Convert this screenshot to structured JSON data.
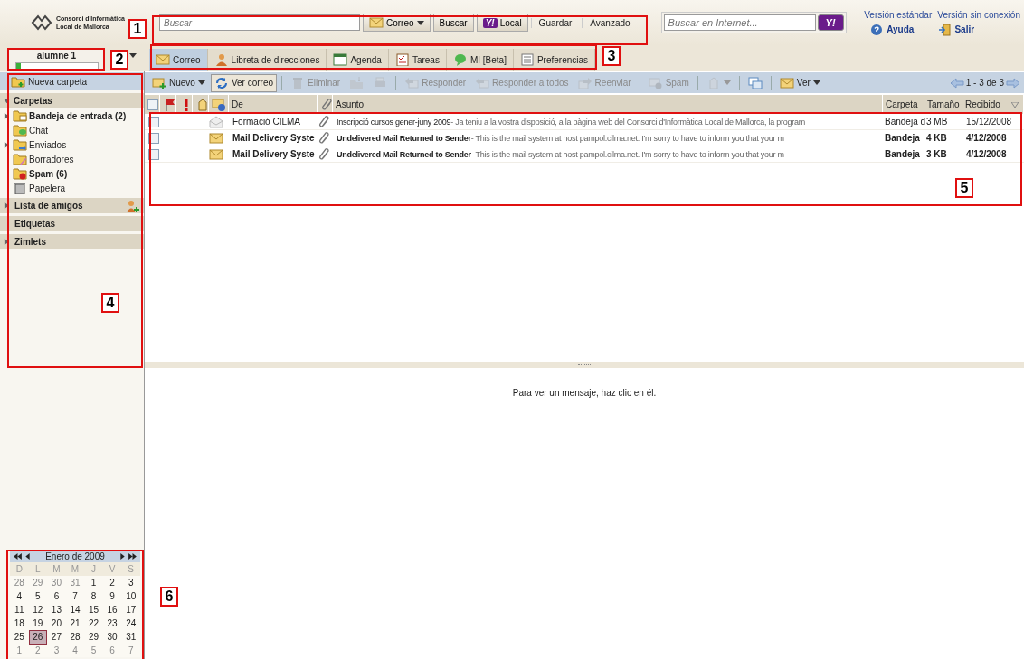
{
  "header": {
    "logo_lines": [
      "Consorci d'Informàtica",
      "Local de Mallorca"
    ],
    "search": {
      "placeholder": "Buscar"
    },
    "search_scope": "Correo",
    "search_button": "Buscar",
    "local_button": {
      "mark": "Y!",
      "label": "Local"
    },
    "save_link": "Guardar",
    "advanced_link": "Avanzado",
    "web_search": {
      "placeholder": "Buscar en Internet...",
      "mark": "Y!"
    },
    "links": [
      "Versión estándar",
      "Versión sin conexión"
    ],
    "help": "Ayuda",
    "logout": "Salir"
  },
  "user": {
    "name": "alumne 1",
    "level": 0.06
  },
  "tabs": [
    {
      "label": "Correo",
      "selected": true
    },
    {
      "label": "Libreta de direcciones",
      "selected": false
    },
    {
      "label": "Agenda",
      "selected": false
    },
    {
      "label": "Tareas",
      "selected": false
    },
    {
      "label": "MI [Beta]",
      "selected": false
    },
    {
      "label": "Preferencias",
      "selected": false
    }
  ],
  "new_folder": "Nueva carpeta",
  "folders_section": {
    "title": "Carpetas",
    "expanded": true
  },
  "folders": [
    {
      "name": "Bandeja de entrada (2)",
      "unread": true,
      "expandable": true
    },
    {
      "name": "Chat",
      "unread": false,
      "expandable": false
    },
    {
      "name": "Enviados",
      "unread": false,
      "expandable": true
    },
    {
      "name": "Borradores",
      "unread": false,
      "expandable": false
    },
    {
      "name": "Spam (6)",
      "unread": true,
      "expandable": false
    },
    {
      "name": "Papelera",
      "unread": false,
      "expandable": false
    }
  ],
  "sections": [
    {
      "title": "Lista de amigos",
      "expanded": false,
      "expandable": true,
      "add": true
    },
    {
      "title": "Etiquetas",
      "expandable": false,
      "add": false
    },
    {
      "title": "Zimlets",
      "expanded": false,
      "expandable": true,
      "add": false
    }
  ],
  "calendar": {
    "title": "Enero de 2009",
    "weekdays": [
      "D",
      "L",
      "M",
      "M",
      "J",
      "V",
      "S"
    ],
    "weeks": [
      [
        {
          "d": "28",
          "other": true,
          "selected": false
        },
        {
          "d": "29",
          "other": true,
          "selected": false
        },
        {
          "d": "30",
          "other": true,
          "selected": false
        },
        {
          "d": "31",
          "other": true,
          "selected": false
        },
        {
          "d": "1",
          "other": false,
          "selected": false
        },
        {
          "d": "2",
          "other": false,
          "selected": false
        },
        {
          "d": "3",
          "other": false,
          "selected": false
        }
      ],
      [
        {
          "d": "4",
          "other": false,
          "selected": false
        },
        {
          "d": "5",
          "other": false,
          "selected": false
        },
        {
          "d": "6",
          "other": false,
          "selected": false
        },
        {
          "d": "7",
          "other": false,
          "selected": false
        },
        {
          "d": "8",
          "other": false,
          "selected": false
        },
        {
          "d": "9",
          "other": false,
          "selected": false
        },
        {
          "d": "10",
          "other": false,
          "selected": false
        }
      ],
      [
        {
          "d": "11",
          "other": false,
          "selected": false
        },
        {
          "d": "12",
          "other": false,
          "selected": false
        },
        {
          "d": "13",
          "other": false,
          "selected": false
        },
        {
          "d": "14",
          "other": false,
          "selected": false
        },
        {
          "d": "15",
          "other": false,
          "selected": false
        },
        {
          "d": "16",
          "other": false,
          "selected": false
        },
        {
          "d": "17",
          "other": false,
          "selected": false
        }
      ],
      [
        {
          "d": "18",
          "other": false,
          "selected": false
        },
        {
          "d": "19",
          "other": false,
          "selected": false
        },
        {
          "d": "20",
          "other": false,
          "selected": false
        },
        {
          "d": "21",
          "other": false,
          "selected": false
        },
        {
          "d": "22",
          "other": false,
          "selected": false
        },
        {
          "d": "23",
          "other": false,
          "selected": false
        },
        {
          "d": "24",
          "other": false,
          "selected": false
        }
      ],
      [
        {
          "d": "25",
          "other": false,
          "selected": false
        },
        {
          "d": "26",
          "other": false,
          "selected": true
        },
        {
          "d": "27",
          "other": false,
          "selected": false
        },
        {
          "d": "28",
          "other": false,
          "selected": false
        },
        {
          "d": "29",
          "other": false,
          "selected": false
        },
        {
          "d": "30",
          "other": false,
          "selected": false
        },
        {
          "d": "31",
          "other": false,
          "selected": false
        }
      ],
      [
        {
          "d": "1",
          "other": true,
          "selected": false
        },
        {
          "d": "2",
          "other": true,
          "selected": false
        },
        {
          "d": "3",
          "other": true,
          "selected": false
        },
        {
          "d": "4",
          "other": true,
          "selected": false
        },
        {
          "d": "5",
          "other": true,
          "selected": false
        },
        {
          "d": "6",
          "other": true,
          "selected": false
        },
        {
          "d": "7",
          "other": true,
          "selected": false
        }
      ]
    ]
  },
  "toolbar": [
    {
      "kind": "button",
      "label": "Nuevo",
      "disabled": false,
      "pressed": false,
      "caret": true
    },
    {
      "kind": "button",
      "label": "Ver correo",
      "disabled": false,
      "pressed": true,
      "caret": false
    },
    {
      "kind": "sep"
    },
    {
      "kind": "button",
      "label": "Eliminar",
      "disabled": true,
      "pressed": false,
      "caret": false
    },
    {
      "kind": "button",
      "disabled": true,
      "pressed": false,
      "caret": false
    },
    {
      "kind": "button",
      "disabled": true,
      "pressed": false,
      "caret": false
    },
    {
      "kind": "sep"
    },
    {
      "kind": "button",
      "label": "Responder",
      "disabled": true,
      "pressed": false,
      "caret": false
    },
    {
      "kind": "button",
      "label": "Responder a todos",
      "disabled": true,
      "pressed": false,
      "caret": false
    },
    {
      "kind": "button",
      "label": "Reenviar",
      "disabled": true,
      "pressed": false,
      "caret": false
    },
    {
      "kind": "sep"
    },
    {
      "kind": "button",
      "label": "Spam",
      "disabled": true,
      "pressed": false,
      "caret": false
    },
    {
      "kind": "sep"
    },
    {
      "kind": "button",
      "disabled": true,
      "pressed": false,
      "caret": true
    },
    {
      "kind": "sep"
    },
    {
      "kind": "button",
      "disabled": false,
      "pressed": false,
      "caret": false
    },
    {
      "kind": "sep"
    },
    {
      "kind": "button",
      "label": "Ver",
      "disabled": false,
      "pressed": false,
      "caret": true
    }
  ],
  "pager": "1 - 3 de 3",
  "columns": {
    "from": "De",
    "subject": "Asunto",
    "folder": "Carpeta",
    "size": "Tamaño",
    "received": "Recibido"
  },
  "select_all_checked": false,
  "messages": [
    {
      "from": "Formació CILMA",
      "subject": "Inscripció cursos gener-juny 2009",
      "fragment": " - Ja teniu a la vostra disposició, a la pàgina web del Consorci d'Informàtica Local de Mallorca, la program",
      "folder": "Bandeja d",
      "size": "3 MB",
      "received": "15/12/2008",
      "unread": false,
      "checked": false,
      "attachment": true
    },
    {
      "from": "Mail Delivery Syste",
      "subject": "Undelivered Mail Returned to Sender",
      "fragment": " - This is the mail system at host pampol.cilma.net. I'm sorry to have to inform you that your m",
      "folder": "Bandeja",
      "size": "4 KB",
      "received": "4/12/2008",
      "unread": true,
      "checked": false,
      "attachment": true
    },
    {
      "from": "Mail Delivery Syste",
      "subject": "Undelivered Mail Returned to Sender",
      "fragment": " - This is the mail system at host pampol.cilma.net. I'm sorry to have to inform you that your m",
      "folder": "Bandeja",
      "size": "3 KB",
      "received": "4/12/2008",
      "unread": true,
      "checked": false,
      "attachment": true
    }
  ],
  "reading_pane": "Para ver un mensaje, haz clic en él.",
  "callouts": [
    {
      "label": "1"
    },
    {
      "label": "2"
    },
    {
      "label": "3"
    },
    {
      "label": "4"
    },
    {
      "label": "5"
    },
    {
      "label": "6"
    }
  ]
}
